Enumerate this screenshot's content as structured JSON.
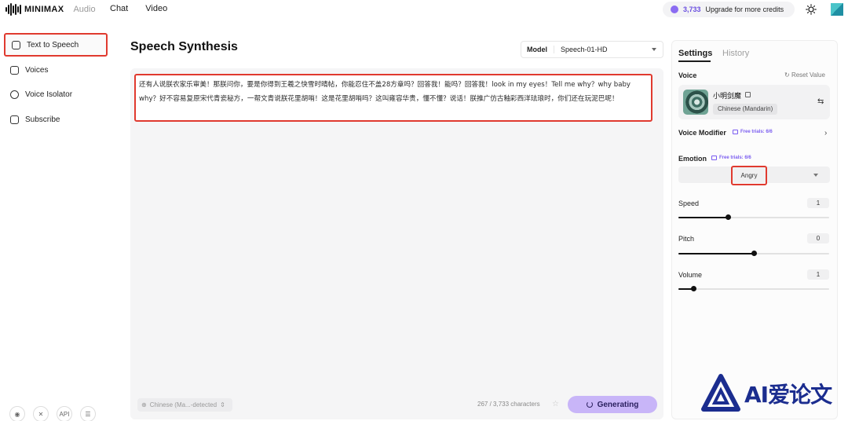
{
  "brand": {
    "name": "MINIMAX",
    "section": "Audio"
  },
  "topnav": [
    "Chat",
    "Video"
  ],
  "credits": {
    "amount": "3,733",
    "upgrade_label": "Upgrade for more credits",
    "accent": "#8b6cf2"
  },
  "sidebar": {
    "items": [
      {
        "label": "Text to Speech",
        "icon": "text-to-speech-icon",
        "active": true
      },
      {
        "label": "Voices",
        "icon": "voices-icon"
      },
      {
        "label": "Voice Isolator",
        "icon": "voice-isolator-icon"
      },
      {
        "label": "Subscribe",
        "icon": "subscribe-icon"
      }
    ],
    "bottom": [
      "discord-icon",
      "x-icon",
      "API",
      "menu-icon"
    ]
  },
  "main": {
    "title": "Speech Synthesis",
    "model_label": "Model",
    "model_value": "Speech-01-HD",
    "text": "还有人说朕农家乐审美！那朕问你，要是你得到王羲之快雪时晴帖，你能忍住不盖28方章吗？回答我！能吗？回答我！look in my eyes！Tell me why？why baby why？好不容易复原宋代青瓷秘方，一帮文青说朕花里胡哨！这是花里胡哨吗？这叫雍容华贵，懂不懂？说话！朕推广仿古釉彩西洋珐琅时，你们还在玩泥巴呢！",
    "language": "Chinese (Ma...-detected",
    "char_count": "267 / 3,733 characters",
    "generate_label": "Generating"
  },
  "settings": {
    "tabs": [
      "Settings",
      "History"
    ],
    "voice_label": "Voice",
    "reset_label": "Reset Value",
    "voice_name": "小明剑魔",
    "voice_lang": "Chinese (Mandarin)",
    "voice_modifier_label": "Voice Modifier",
    "free_trials": "Free trials: 6/6",
    "emotion_label": "Emotion",
    "emotion_value": "Angry",
    "sliders": [
      {
        "label": "Speed",
        "value": "1",
        "fill": 0.33
      },
      {
        "label": "Pitch",
        "value": "0",
        "fill": 0.5
      },
      {
        "label": "Volume",
        "value": "1",
        "fill": 0.1
      }
    ]
  },
  "watermark": {
    "text": "AI爱论文"
  }
}
